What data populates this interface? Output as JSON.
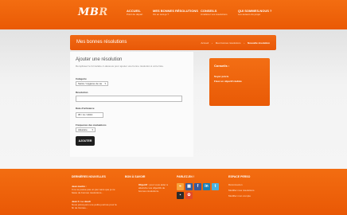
{
  "logo": {
    "text_main": "MB",
    "text_accent": "R"
  },
  "nav": [
    {
      "title": "ACCUEIL",
      "sub": "Point de départ"
    },
    {
      "title": "MES BONNES RÉSOLUTIONS",
      "sub": "Où en suis-je ?"
    },
    {
      "title": "CONSEILS",
      "sub": "Améliorer vos résolutions"
    },
    {
      "title": "QUI SOMMES-NOUS ?",
      "sub": "Les auteurs du projet"
    }
  ],
  "page": {
    "title": "Mes bonnes résolutions",
    "breadcrumb": [
      "Accueil",
      "Mes bonnes résolutions",
      "Nouvelle résolution"
    ]
  },
  "form": {
    "title": "Ajouter une résolution",
    "intro": "Remplissez le formulaire ci-dessous pour ajouter une bonne résolution à votre liste.",
    "category_label": "Catégorie",
    "category_value": "Santé / Hygiène de vie",
    "resolution_label": "Résolution",
    "resolution_value": "",
    "deadline_label": "Date d'échéance",
    "deadline_value": "05 / 11 / 2013",
    "frequency_label": "Fréquence des évaluations",
    "frequency_value": "Aléatoire",
    "submit_label": "AJOUTER"
  },
  "sidebar": {
    "title": "Conseils :",
    "links": [
      "Soyez précis",
      "Fixez un objectif réaliste"
    ]
  },
  "footer": {
    "col1": {
      "title": "DERNIÈRES NOUVELLES",
      "items": [
        {
          "head": "Jean martin :",
          "text": "Il ne se passe pas un jour sans que je ne fasse de bonnes résolutions..."
        },
        {
          "head": "Jean C. Le Jeudi",
          "text": "Nous prévoyons une petite journée pour la fin de l'année..."
        }
      ]
    },
    "col2": {
      "title": "BON À SAVOIR",
      "text_bold": "Objectif",
      "text": ": pour vous aider à atteindre vos objectifs de bonnes résolutions."
    },
    "col3": {
      "title": "PARLEZ-EN !"
    },
    "col4": {
      "title": "ESPACE PERSO",
      "links": [
        "Déconnexion",
        "Modifier mes résolutions",
        "Modifier mon compte"
      ]
    }
  }
}
